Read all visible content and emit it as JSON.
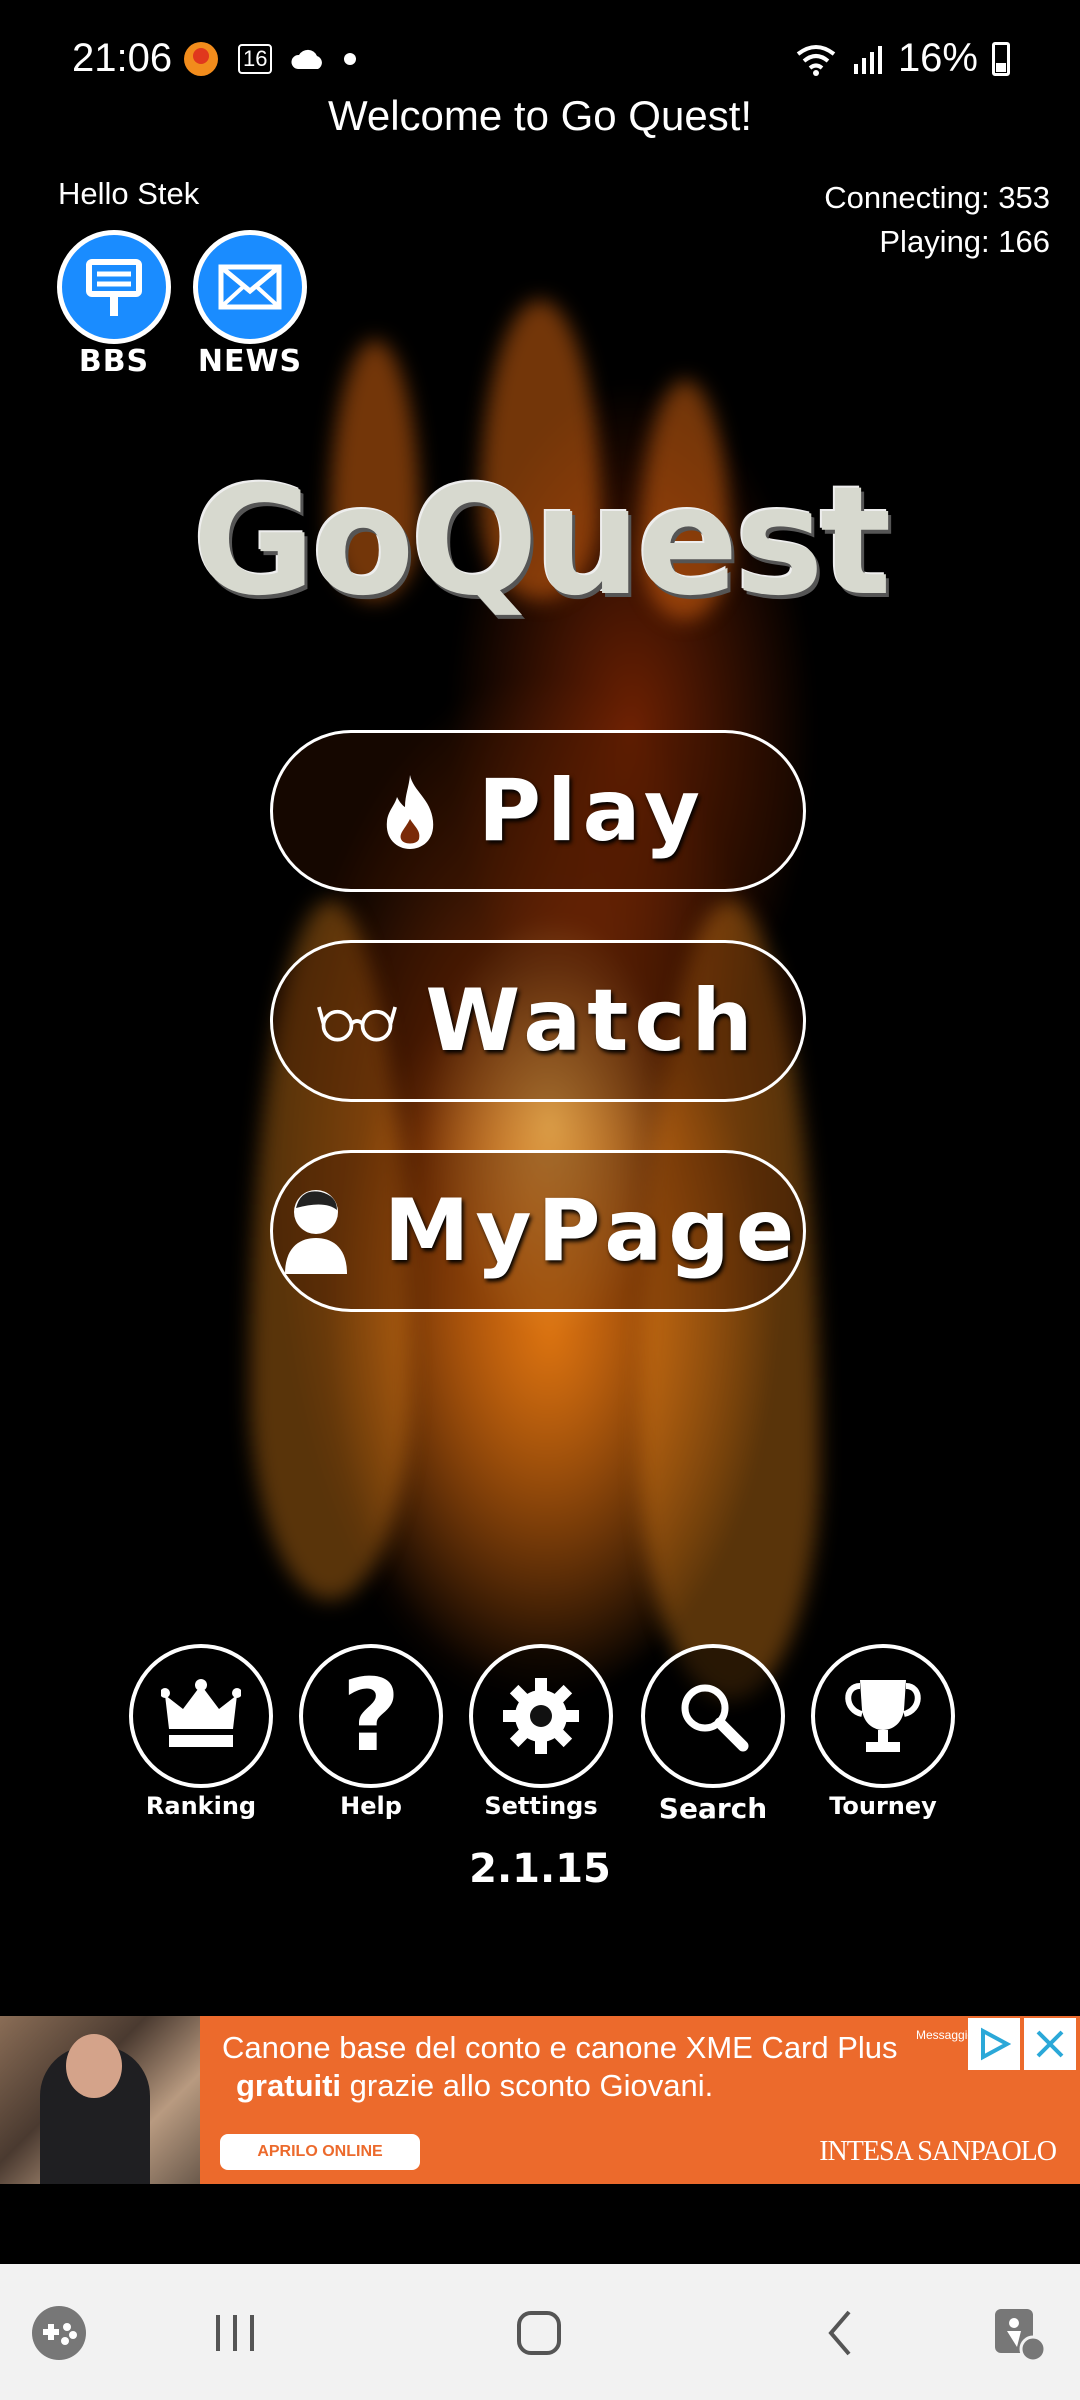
{
  "status_bar": {
    "time": "21:06",
    "badge": "16",
    "battery": "16%"
  },
  "app": {
    "title": "Welcome to Go Quest!"
  },
  "user": {
    "greeting": "Hello Stek"
  },
  "stats": {
    "connecting": "Connecting: 353",
    "playing": "Playing: 166"
  },
  "top_buttons": {
    "bbs": "BBS",
    "news": "NEWS"
  },
  "logo": "GoQuest",
  "menu": {
    "play": "Play",
    "watch": "Watch",
    "mypage": "MyPage"
  },
  "tools": {
    "ranking": "Ranking",
    "help": "Help",
    "settings": "Settings",
    "search": "Search",
    "tourney": "Tourney"
  },
  "version": "2.1.15",
  "ad": {
    "line1": "Canone base del conto e canone XME Card Plus",
    "line2_bold": "gratuiti",
    "line2_rest": " grazie allo sconto Giovani.",
    "cta": "APRILO ONLINE",
    "brand": "INTESA SANPAOLO",
    "tag": "Messaggio"
  },
  "colors": {
    "accent_blue": "#1a8cff",
    "ad_orange": "#ec6a2c"
  }
}
